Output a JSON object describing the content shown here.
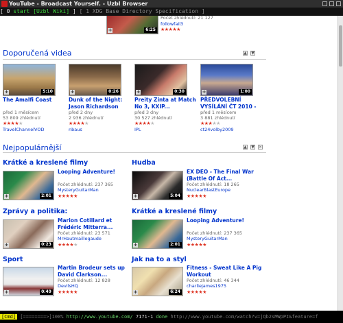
{
  "window": {
    "title": "YouTube - Broadcast Yourself. - Uzbl Browser"
  },
  "tabs": {
    "active_prefix": "[ 0",
    "active_label": "start [Uzbl Wiki]",
    "active_suffix": "]",
    "inactive": "[ 1  XDG Base Directory Specification ]"
  },
  "top_video": {
    "views": "Počet zhlédnutí: 21 127",
    "user": "followfail3",
    "duration": "6:25",
    "stars": 5
  },
  "recommended": {
    "heading": "Doporučená videa",
    "videos": [
      {
        "title": "The Amalfi Coast",
        "age": "před 1 měsícem",
        "views": "53 809 zhlédnutí",
        "user": "TravelChannelVOD",
        "duration": "5:10",
        "stars": 4
      },
      {
        "title": "Dunk of the Night: Jason Richardson",
        "age": "před 2 dny",
        "views": "2 936 zhlédnutí",
        "user": "nbaus",
        "duration": "0:26",
        "stars": 4
      },
      {
        "title": "Preity Zinta at Match No 3, KXIP...",
        "age": "před 3 dny",
        "views": "30 527 zhlédnutí",
        "user": "IPL",
        "duration": "0:30",
        "stars": 4
      },
      {
        "title": "PŘEDVOLEBNÍ VYSÍLÁNÍ ČT 2010 -",
        "age": "před 1 měsícem",
        "views": "3 881 zhlédnutí",
        "user": "ct24volby2009",
        "duration": "1:00",
        "stars": 3
      }
    ]
  },
  "popular": {
    "heading": "Nejpopulárnější",
    "views_label": "Počet zhlédnutí:",
    "categories": [
      {
        "name": "Krátké a kreslené filmy",
        "title": "Looping Adventure!",
        "views": "237 365",
        "user": "MysteryGuitarMan",
        "duration": "2:01"
      },
      {
        "name": "Hudba",
        "title": "EX DEO - The Final War (Battle Of Act...",
        "views": "18 265",
        "user": "NuclearBlastEurope",
        "duration": "5:04"
      },
      {
        "name": "Zprávy a politika:",
        "title": "Marion Cotillard et Frédéric Mitterra...",
        "views": "23 571",
        "user": "MrHautmaillegaude",
        "duration": "0:23"
      },
      {
        "name": "Krátké a kreslené filmy",
        "title": "Looping Adventure!",
        "views": "237 365",
        "user": "MysteryGuitarMan",
        "duration": "2:01"
      },
      {
        "name": "Sport",
        "title": "Martin Brodeur sets up David Clarkson...",
        "views": "12 828",
        "user": "DevilsHQ",
        "duration": "0:49"
      },
      {
        "name": "Jak na to a styl",
        "title": "Fitness - Sweat Like A Pig Workout",
        "views": "46 344",
        "user": "charliejames1975",
        "duration": "6:24"
      }
    ]
  },
  "statusbar": {
    "mode": "[Cmd]",
    "progress": "[========>]100%",
    "url": "http://www.youtube.com/",
    "count": "7171-1",
    "state": "done",
    "hover": "http://www.youtube.com/watch?v=jQb2sMWpPI&feature=f"
  },
  "colors": {
    "link": "#0033cc",
    "star": "#dd3322",
    "statusbar_bg": "#000000",
    "mode_bg": "#e6e600"
  }
}
